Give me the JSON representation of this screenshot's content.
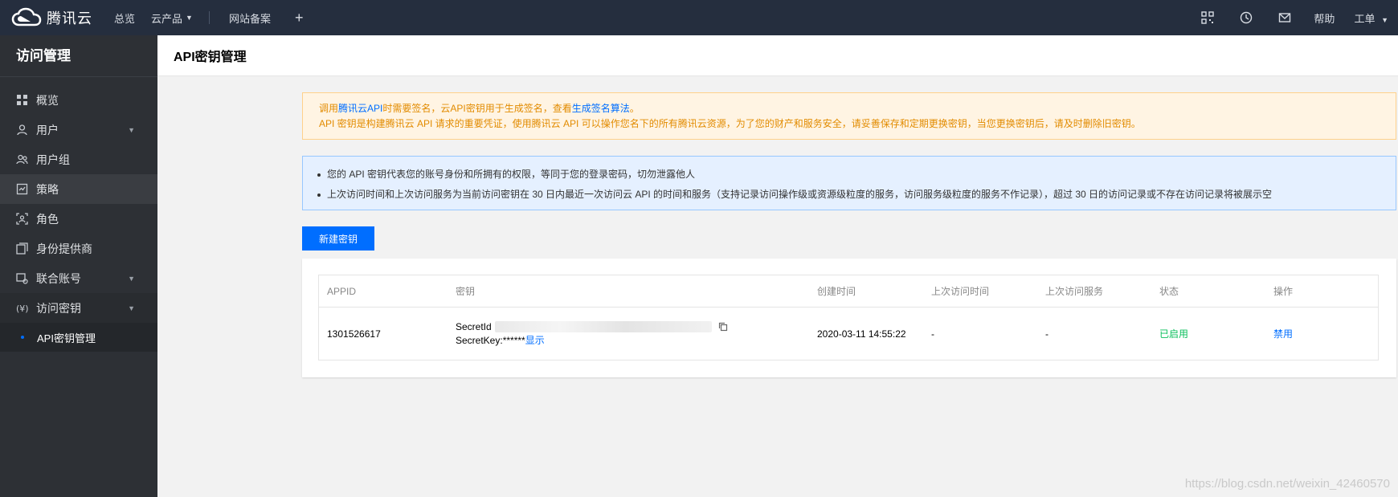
{
  "topbar": {
    "brand": "腾讯云",
    "nav": [
      "总览",
      "云产品",
      "网站备案"
    ],
    "help": "帮助",
    "ticket": "工单"
  },
  "sidebar": {
    "title": "访问管理",
    "items": [
      {
        "label": "概览",
        "icon": "grid-icon"
      },
      {
        "label": "用户",
        "icon": "user-icon",
        "expandable": true
      },
      {
        "label": "用户组",
        "icon": "user-group-icon"
      },
      {
        "label": "策略",
        "icon": "policy-icon"
      },
      {
        "label": "角色",
        "icon": "role-icon"
      },
      {
        "label": "身份提供商",
        "icon": "identity-provider-icon"
      },
      {
        "label": "联合账号",
        "icon": "federated-account-icon",
        "expandable": true
      },
      {
        "label": "访问密钥",
        "icon": "key-icon",
        "expandable": true
      }
    ],
    "sub_item": "API密钥管理"
  },
  "header": {
    "title": "API密钥管理"
  },
  "warning": {
    "line1_a": "调用",
    "line1_link1": "腾讯云API",
    "line1_b": "时需要签名，云API密钥用于生成签名，查看",
    "line1_link2": "生成签名算法",
    "line1_c": "。",
    "line2": "API 密钥是构建腾讯云 API 请求的重要凭证，使用腾讯云 API 可以操作您名下的所有腾讯云资源，为了您的财产和服务安全，请妥善保存和定期更换密钥，当您更换密钥后，请及时删除旧密钥。"
  },
  "info": {
    "items": [
      "您的 API 密钥代表您的账号身份和所拥有的权限，等同于您的登录密码，切勿泄露他人",
      "上次访问时间和上次访问服务为当前访问密钥在 30 日内最近一次访问云 API 的时间和服务（支持记录访问操作级或资源级粒度的服务，访问服务级粒度的服务不作记录），超过 30 日的访问记录或不存在访问记录将被展示空"
    ]
  },
  "actions": {
    "new_key": "新建密钥"
  },
  "table": {
    "headers": [
      "APPID",
      "密钥",
      "创建时间",
      "上次访问时间",
      "上次访问服务",
      "状态",
      "操作"
    ],
    "rows": [
      {
        "appid": "1301526617",
        "secret_id_label": "SecretId",
        "secret_key_label": "SecretKey:******",
        "show": "显示",
        "created": "2020-03-11 14:55:22",
        "last_access_time": "-",
        "last_access_service": "-",
        "status": "已启用",
        "op": "禁用"
      }
    ]
  },
  "watermark": "https://blog.csdn.net/weixin_42460570",
  "colors": {
    "topbar": "#252e3e",
    "sidebar": "#2d3035",
    "accent": "#006eff",
    "success": "#0abf5b",
    "warning_text": "#e28b00"
  }
}
